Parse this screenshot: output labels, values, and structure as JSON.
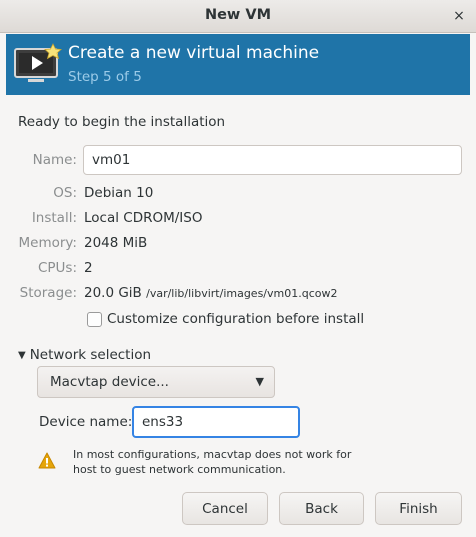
{
  "window": {
    "title": "New VM",
    "close_glyph": "×"
  },
  "banner": {
    "title": "Create a new virtual machine",
    "step": "Step 5 of 5",
    "icon": "monitor-star-icon",
    "bg_color": "#1f74a8"
  },
  "summary": {
    "heading": "Ready to begin the installation",
    "name_label": "Name:",
    "name_value": "vm01",
    "os_label": "OS:",
    "os_value": "Debian 10",
    "install_label": "Install:",
    "install_value": "Local CDROM/ISO",
    "memory_label": "Memory:",
    "memory_value": "2048 MiB",
    "cpus_label": "CPUs:",
    "cpus_value": "2",
    "storage_label": "Storage:",
    "storage_size": "20.0 GiB",
    "storage_path": "/var/lib/libvirt/images/vm01.qcow2",
    "customize_label": "Customize configuration before install",
    "customize_checked": false
  },
  "network": {
    "expander_label": "Network selection",
    "expander_glyph": "▼",
    "combo_selected": "Macvtap device...",
    "combo_arrow": "▼",
    "device_name_label": "Device name:",
    "device_name_value": "ens33",
    "warning_icon": "warning-icon",
    "warning_text": "In most configurations, macvtap does not work for host to guest network communication."
  },
  "buttons": {
    "cancel": "Cancel",
    "back": "Back",
    "finish": "Finish"
  },
  "colors": {
    "accent_focus": "#3584e4",
    "warning": "#e5a50a"
  }
}
